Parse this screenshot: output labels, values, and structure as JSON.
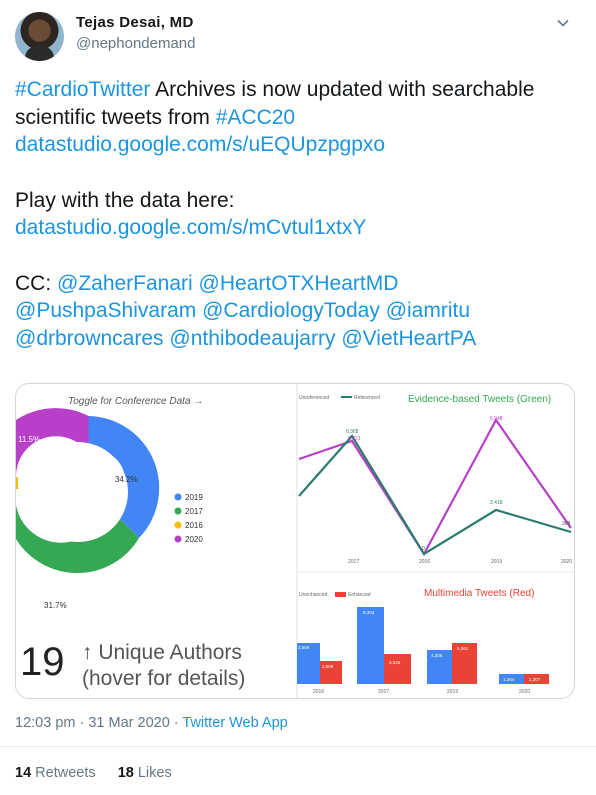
{
  "user": {
    "display_name": "Tejas Desai, MD",
    "handle": "@nephondemand"
  },
  "tweet": {
    "line1_tag": "#CardioTwitter",
    "line1_text": " Archives is now updated with searchable",
    "line2_text": "scientific tweets from ",
    "line2_tag": "#ACC20",
    "link1": "datastudio.google.com/s/uEQUpzpgpxo",
    "line4_text": "Play with the data here:",
    "link2": "datastudio.google.com/s/mCvtul1xtxY",
    "cc_label": "CC: ",
    "mentions_line1": [
      "@ZaherFanari",
      "@HeartOTXHeartMD"
    ],
    "mentions_line2": [
      "@PushpaShivaram",
      "@CardiologyToday",
      "@iamritu"
    ],
    "mentions_line3": [
      "@drbrowncares",
      "@nthibodeaujarry",
      "@VietHeartPA"
    ]
  },
  "card": {
    "donut": {
      "toggle_label": "Toggle for Conference Data →",
      "legend": [
        "2019",
        "2017",
        "2016",
        "2020"
      ],
      "colors": [
        "#4285f4",
        "#34a853",
        "#fbbc05",
        "#b840c9"
      ],
      "labels": [
        "34.2%",
        "31.7%",
        "11.5%"
      ],
      "authors_count": "19",
      "authors_line1": "↑ Unique Authors",
      "authors_line2": "(hover for details)"
    },
    "evidence_chart": {
      "title": "Evidence-based Tweets (Green)",
      "legend": [
        "Unreferenced",
        "Referenced"
      ],
      "x": [
        "2017",
        "2016",
        "2019",
        "2020"
      ],
      "point_labels_purple": [
        "6,368",
        "0",
        "6,948",
        "388"
      ],
      "point_labels_green": [
        "5,921",
        "0",
        "2,418",
        "388"
      ]
    },
    "multimedia_chart": {
      "title": "Multimedia Tweets (Red)",
      "legend": [
        "Unenhanced",
        "Enhanced"
      ],
      "x": [
        "2016",
        "2017",
        "2019",
        "2020"
      ],
      "blue_labels": [
        "3,558",
        "9,304",
        "4,305",
        "1,264"
      ],
      "red_labels": [
        "2,009",
        "3,025",
        "5,061",
        "1,307"
      ]
    }
  },
  "meta": {
    "time": "12:03 pm · 31 Mar 2020 · ",
    "app": "Twitter Web App"
  },
  "stats": {
    "retweets_count": "14",
    "retweets_label": " Retweets",
    "likes_count": "18",
    "likes_label": " Likes"
  },
  "colors": {
    "link": "#1b95e0",
    "muted": "#657786",
    "purple": "#b840c9",
    "teal": "#2a7d6e",
    "red": "#ea4335",
    "blue": "#4285f4"
  }
}
